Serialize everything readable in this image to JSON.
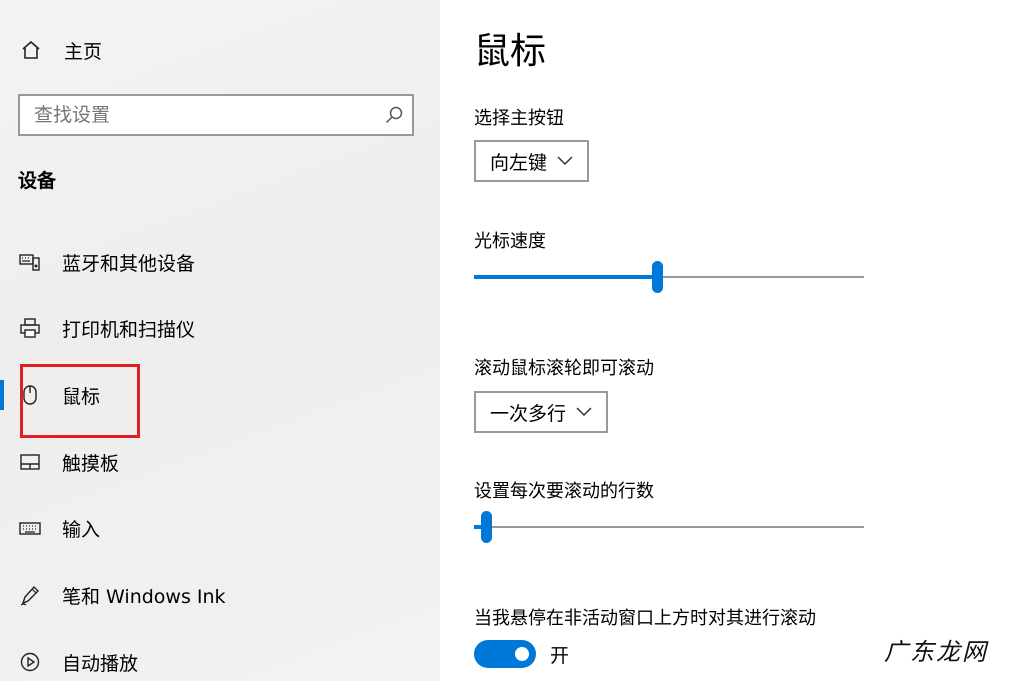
{
  "sidebar": {
    "home_label": "主页",
    "search": {
      "placeholder": "查找设置"
    },
    "section_title": "设备",
    "items": [
      {
        "label": "蓝牙和其他设备",
        "icon": "keyboard-speaker-icon"
      },
      {
        "label": "打印机和扫描仪",
        "icon": "printer-icon"
      },
      {
        "label": "鼠标",
        "icon": "mouse-icon",
        "active": true
      },
      {
        "label": "触摸板",
        "icon": "touchpad-icon"
      },
      {
        "label": "输入",
        "icon": "keyboard-icon"
      },
      {
        "label": "笔和 Windows Ink",
        "icon": "pen-icon"
      },
      {
        "label": "自动播放",
        "icon": "autoplay-icon"
      }
    ]
  },
  "main": {
    "title": "鼠标",
    "primary_button": {
      "label": "选择主按钮",
      "value": "向左键"
    },
    "cursor_speed": {
      "label": "光标速度",
      "level": 0.47
    },
    "scroll_mode": {
      "label": "滚动鼠标滚轮即可滚动",
      "value": "一次多行"
    },
    "scroll_lines": {
      "label": "设置每次要滚动的行数",
      "level": 0.03
    },
    "inactive_scroll": {
      "label": "当我悬停在非活动窗口上方时对其进行滚动",
      "state": "开"
    }
  },
  "watermark": "广东龙网",
  "colors": {
    "accent": "#0078d7",
    "highlight": "#e02020"
  }
}
